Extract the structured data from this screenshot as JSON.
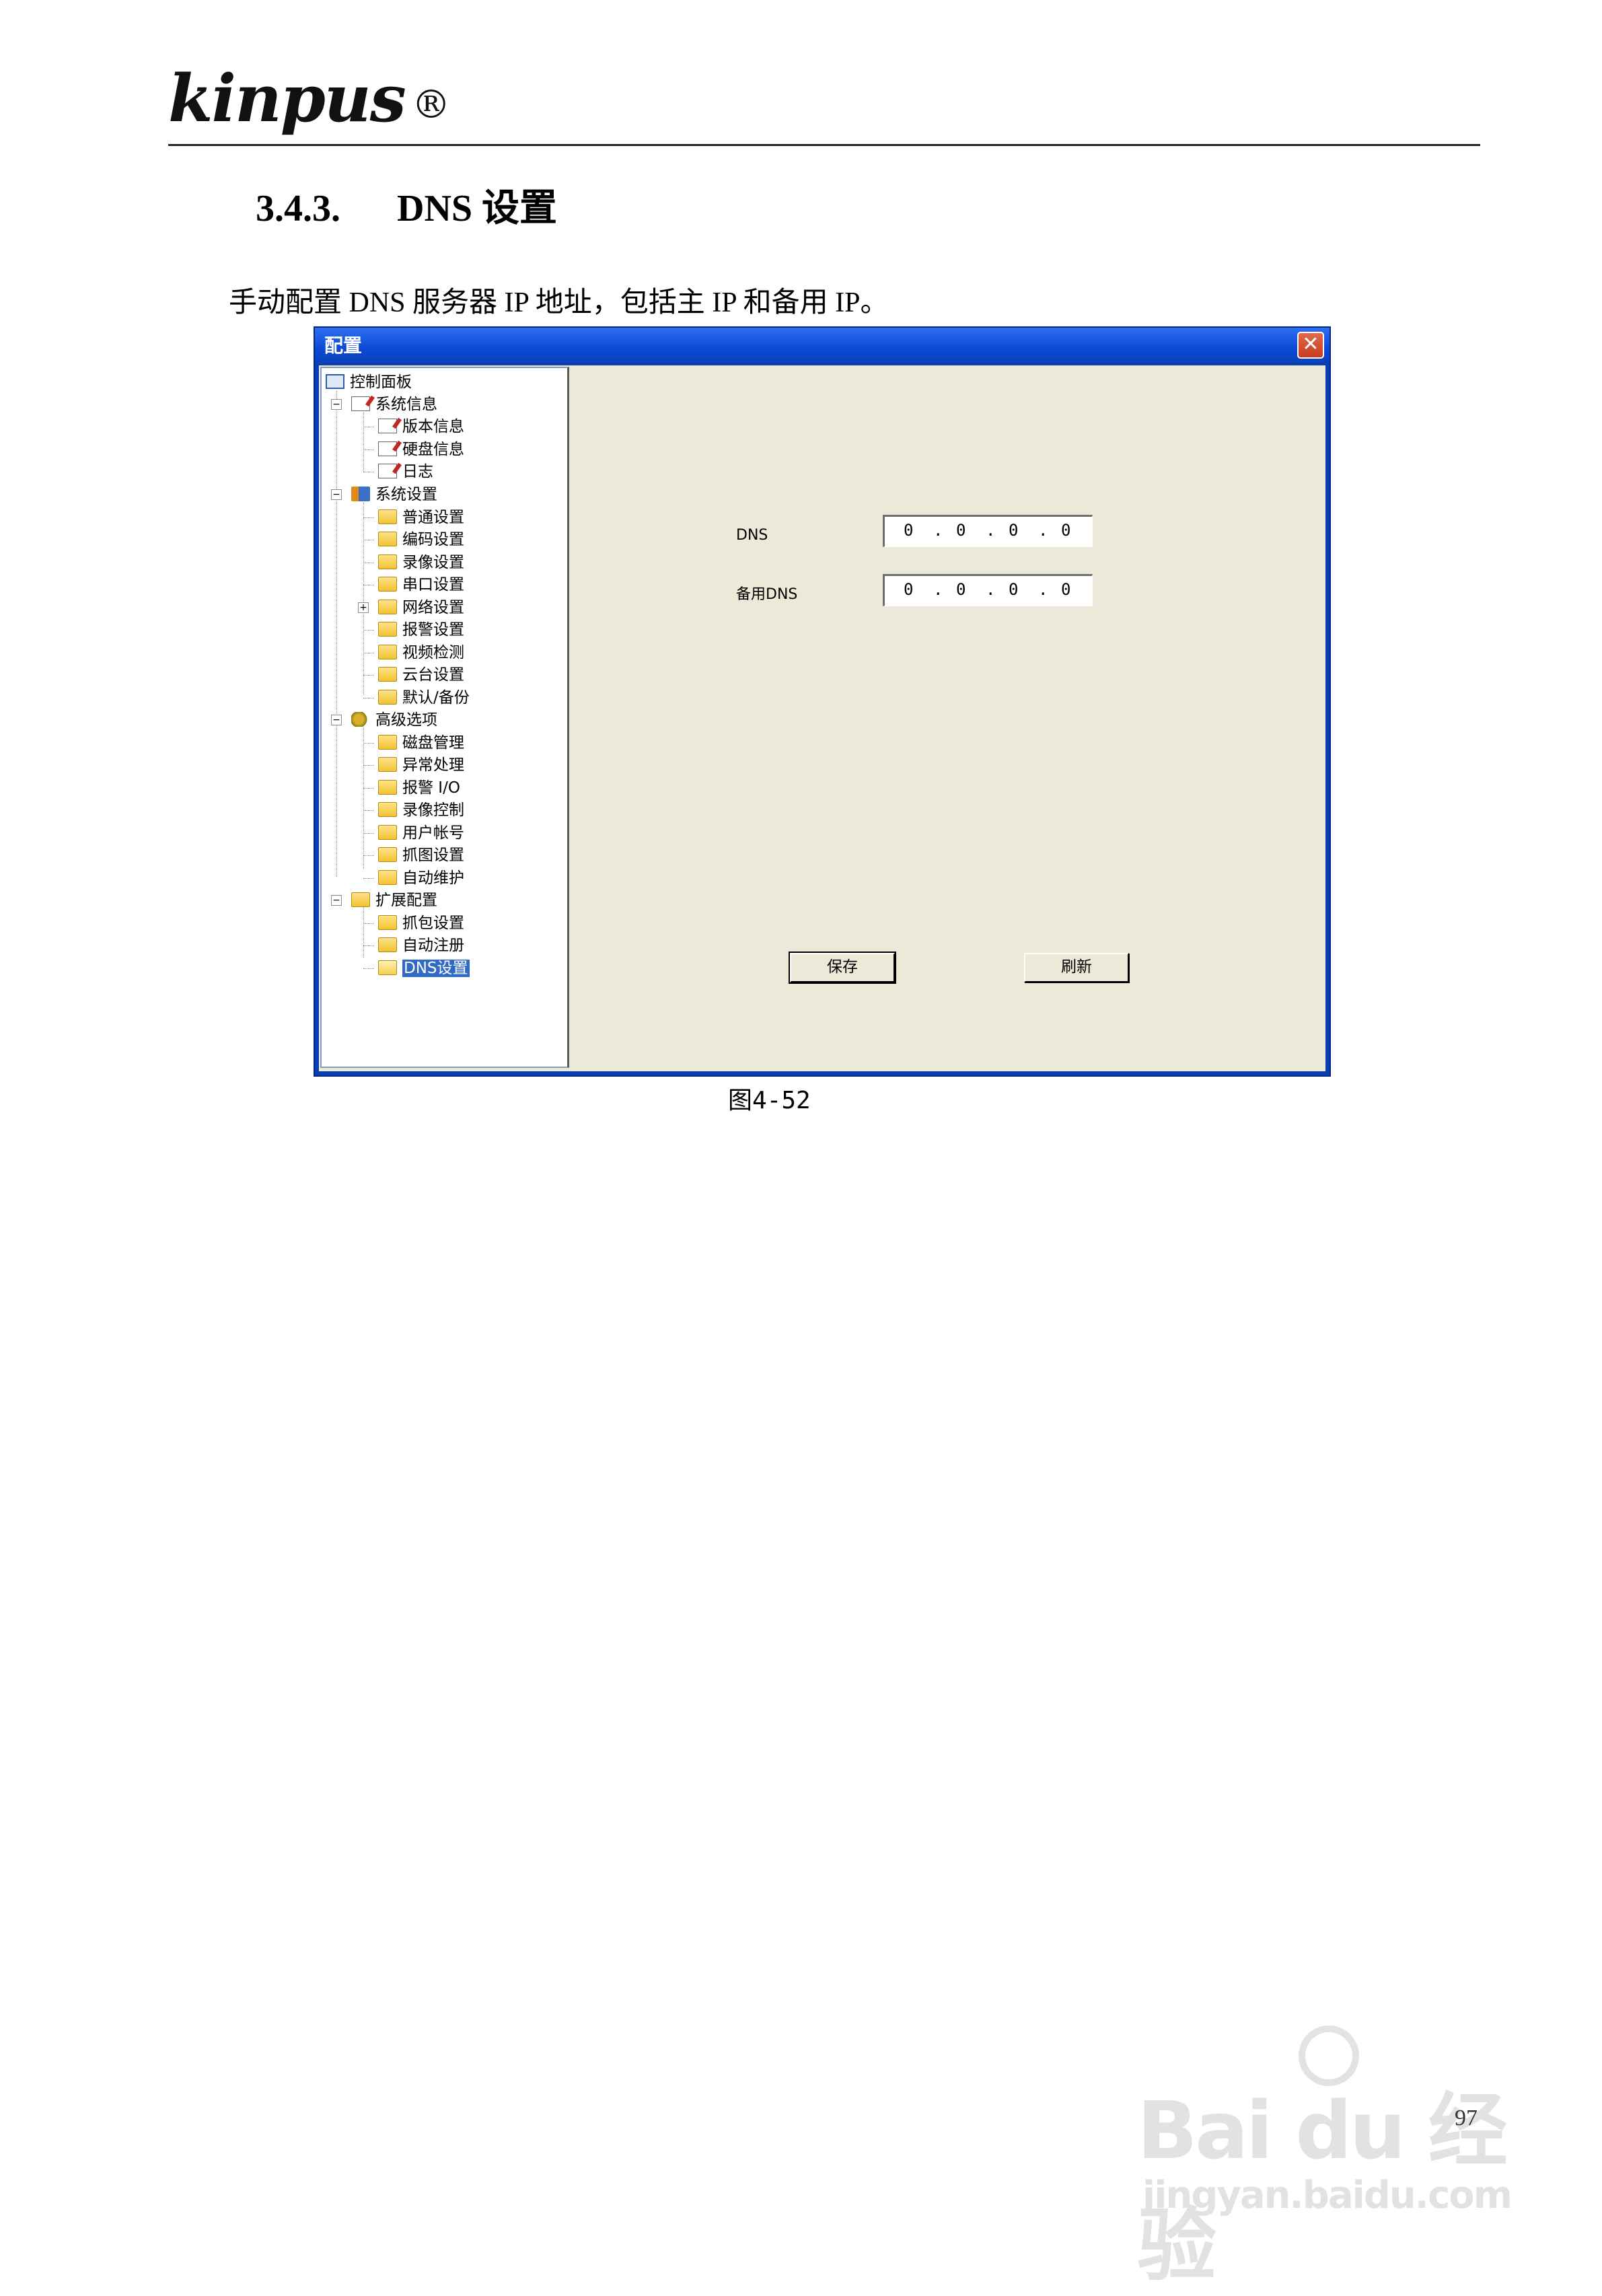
{
  "header": {
    "logo": "kinpus",
    "logo_mark": "®"
  },
  "section": {
    "number": "3.4.3.",
    "title": "DNS 设置"
  },
  "intro_text": "手动配置 DNS 服务器 IP 地址，包括主 IP 和备用 IP。",
  "window": {
    "title": "配置",
    "close_icon": "close-icon",
    "tree": {
      "root": {
        "label": "控制面板",
        "icon": "control-panel-icon"
      },
      "groups": [
        {
          "label": "系统信息",
          "icon": "notepad-icon",
          "expanded": true,
          "items": [
            "版本信息",
            "硬盘信息",
            "日志"
          ]
        },
        {
          "label": "系统设置",
          "icon": "tools-icon",
          "expanded": true,
          "items": [
            "普通设置",
            "编码设置",
            "录像设置",
            "串口设置",
            "网络设置",
            "报警设置",
            "视频检测",
            "云台设置",
            "默认/备份"
          ]
        },
        {
          "label": "高级选项",
          "icon": "gears-icon",
          "expanded": true,
          "items": [
            "磁盘管理",
            "异常处理",
            "报警 I/O",
            "录像控制",
            "用户帐号",
            "抓图设置",
            "自动维护"
          ]
        },
        {
          "label": "扩展配置",
          "icon": "folder-icon",
          "expanded": true,
          "items": [
            "抓包设置",
            "自动注册",
            "DNS设置"
          ]
        }
      ],
      "selected": "DNS设置"
    },
    "form": {
      "dns_label": "DNS",
      "dns_value": [
        "0",
        "0",
        "0",
        "0"
      ],
      "backup_dns_label": "备用DNS",
      "backup_dns_value": [
        "0",
        "0",
        "0",
        "0"
      ],
      "save_label": "保存",
      "refresh_label": "刷新"
    }
  },
  "caption": "图4-52",
  "page_number": "97",
  "watermark": {
    "main": "Bai du 经验",
    "sub": "jingyan.baidu.com"
  },
  "colors": {
    "titlebar": "#0b49d6",
    "client_bg": "#ece9d8",
    "selection": "#316ac5"
  }
}
